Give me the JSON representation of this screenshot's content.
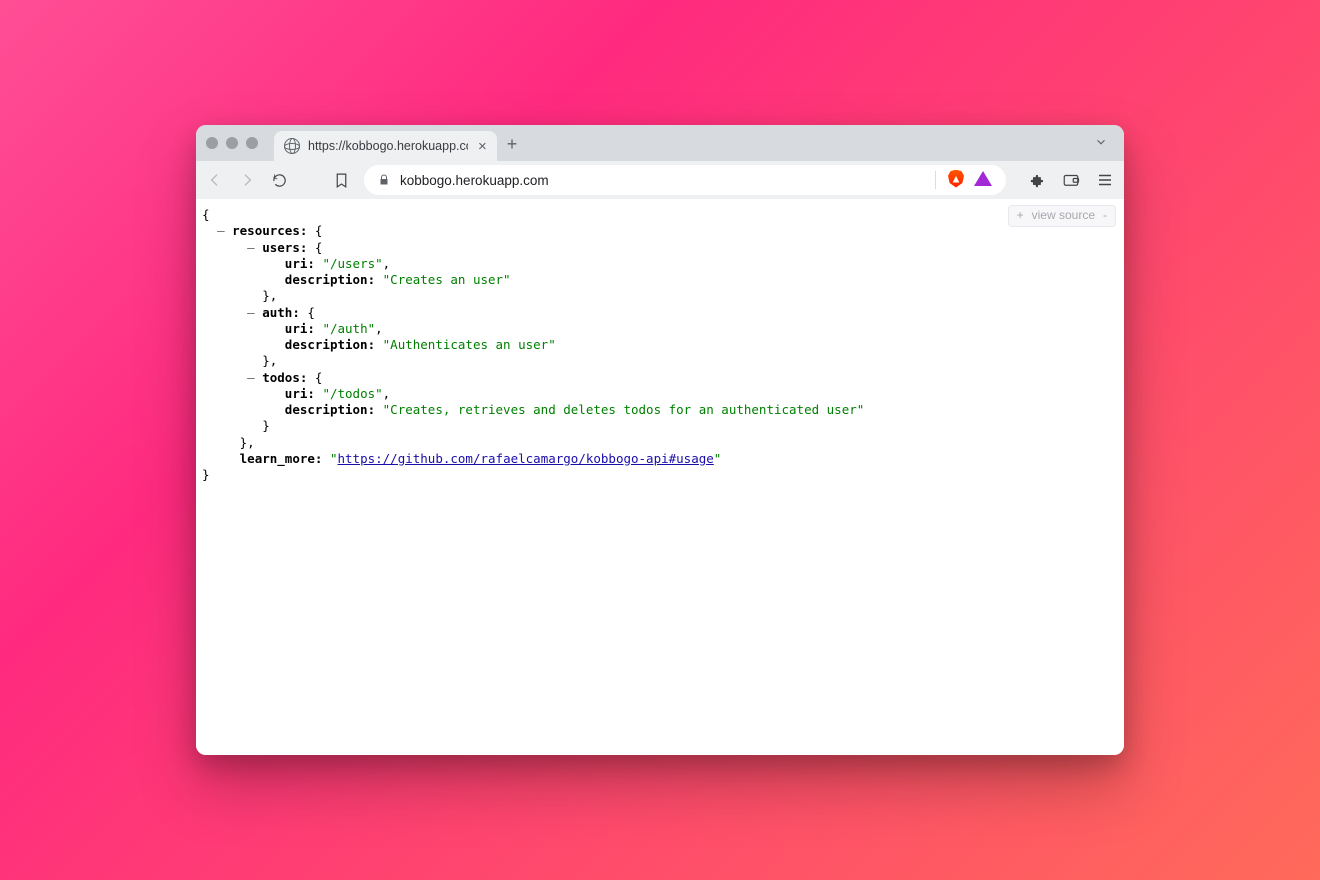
{
  "tab": {
    "title": "https://kobbogo.herokuapp.com"
  },
  "address": {
    "url": "kobbogo.herokuapp.com"
  },
  "viewsource": {
    "plus": "+",
    "label": "view source",
    "minus": "-"
  },
  "json": {
    "resources_key": "resources:",
    "users_key": "users:",
    "uri_key": "uri:",
    "description_key": "description:",
    "auth_key": "auth:",
    "todos_key": "todos:",
    "learn_more_key": "learn_more:",
    "users_uri": "\"/users\"",
    "users_desc": "\"Creates an user\"",
    "auth_uri": "\"/auth\"",
    "auth_desc": "\"Authenticates an user\"",
    "todos_uri": "\"/todos\"",
    "todos_desc": "\"Creates, retrieves and deletes todos for an authenticated user\"",
    "learn_more_url": "https://github.com/rafaelcamargo/kobbogo-api#usage"
  }
}
